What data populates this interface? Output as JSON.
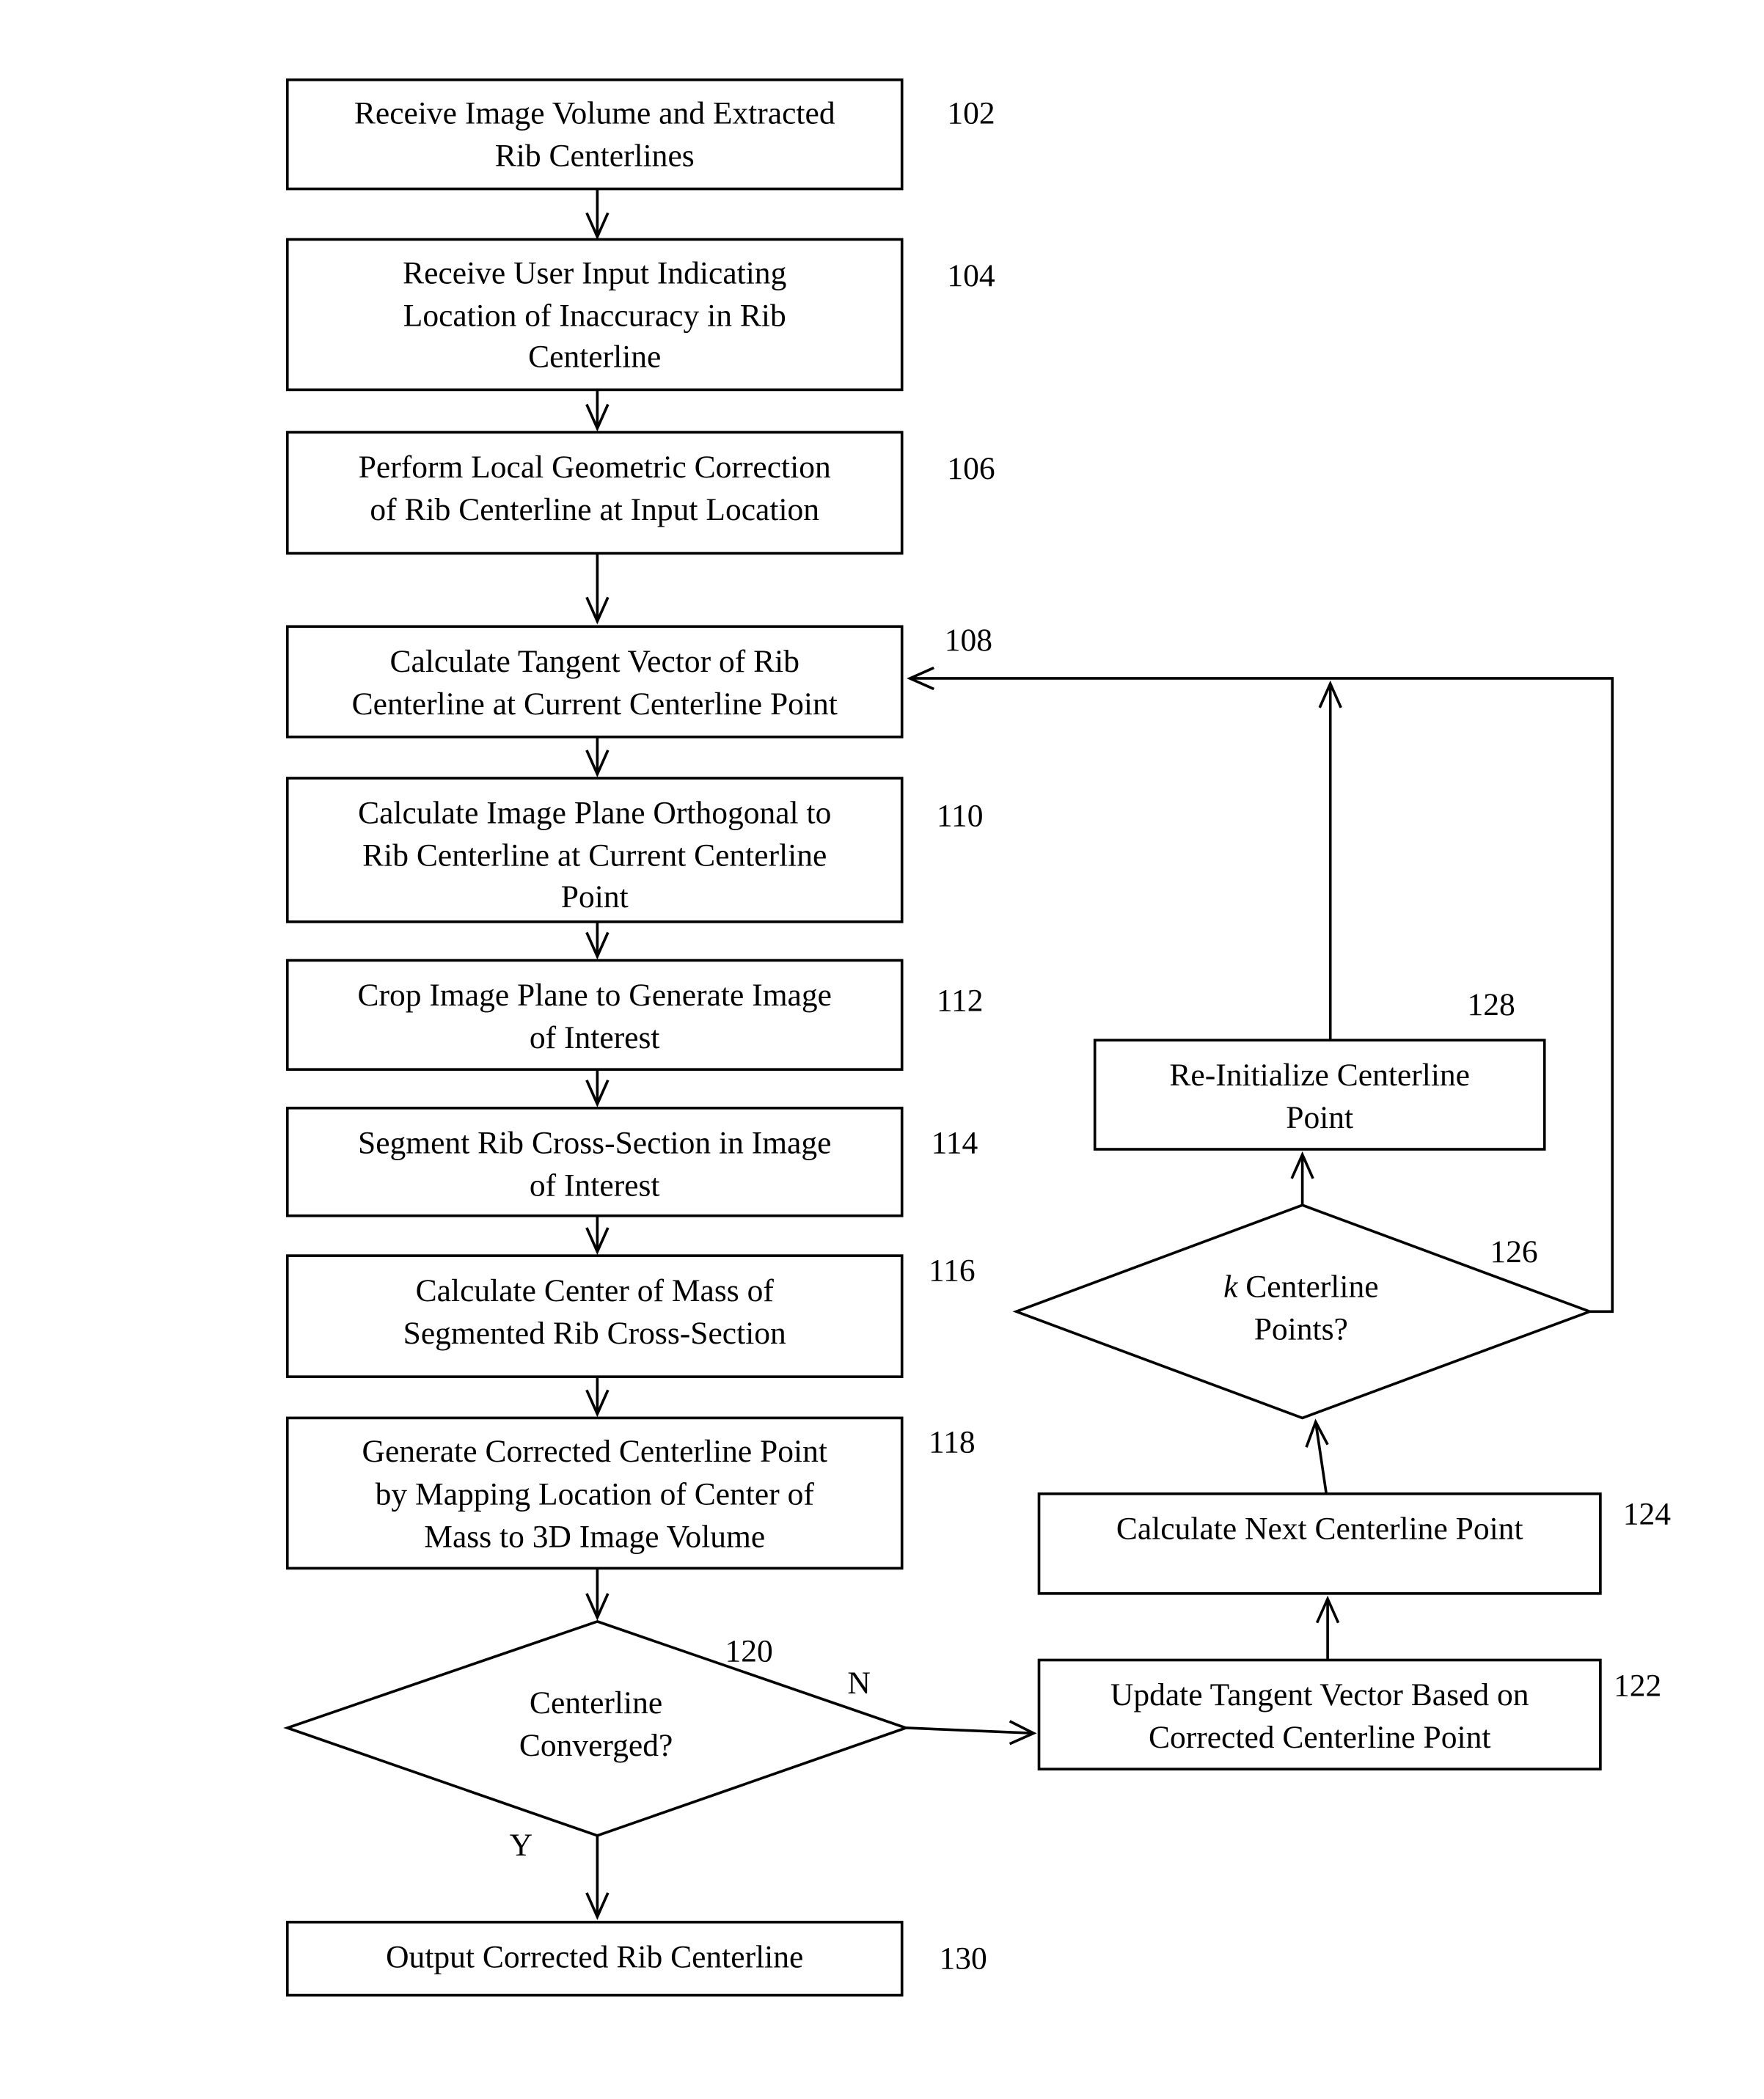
{
  "diagram": {
    "type": "flowchart",
    "steps": [
      {
        "id": "102",
        "ref": "102",
        "lines": [
          "Receive Image Volume and Extracted",
          "Rib Centerlines"
        ]
      },
      {
        "id": "104",
        "ref": "104",
        "lines": [
          "Receive User Input Indicating",
          "Location of Inaccuracy in Rib",
          "Centerline"
        ]
      },
      {
        "id": "106",
        "ref": "106",
        "lines": [
          "Perform Local Geometric Correction",
          "of Rib Centerline at Input Location"
        ]
      },
      {
        "id": "108",
        "ref": "108",
        "lines": [
          "Calculate Tangent Vector of Rib",
          "Centerline at Current Centerline Point"
        ]
      },
      {
        "id": "110",
        "ref": "110",
        "lines": [
          "Calculate Image Plane Orthogonal to",
          "Rib Centerline at Current Centerline",
          "Point"
        ]
      },
      {
        "id": "112",
        "ref": "112",
        "lines": [
          "Crop Image Plane to Generate Image",
          "of Interest"
        ]
      },
      {
        "id": "114",
        "ref": "114",
        "lines": [
          "Segment Rib Cross-Section in Image",
          "of Interest"
        ]
      },
      {
        "id": "116",
        "ref": "116",
        "lines": [
          "Calculate Center of Mass of",
          "Segmented Rib Cross-Section"
        ]
      },
      {
        "id": "118",
        "ref": "118",
        "lines": [
          "Generate Corrected Centerline Point",
          "by Mapping Location of Center of",
          "Mass to 3D Image Volume"
        ]
      },
      {
        "id": "120",
        "ref": "120",
        "lines": [
          "Centerline",
          "Converged?"
        ],
        "decision": true,
        "yes_label": "Y",
        "no_label": "N"
      },
      {
        "id": "122",
        "ref": "122",
        "lines": [
          "Update Tangent Vector Based on",
          "Corrected Centerline Point"
        ]
      },
      {
        "id": "124",
        "ref": "124",
        "lines": [
          "Calculate Next Centerline Point"
        ]
      },
      {
        "id": "126",
        "ref": "126",
        "lines": [
          "k",
          " Centerline",
          "Points?"
        ],
        "decision": true
      },
      {
        "id": "128",
        "ref": "128",
        "lines": [
          "Re-Initialize Centerline",
          "Point"
        ]
      },
      {
        "id": "130",
        "ref": "130",
        "lines": [
          "Output Corrected Rib Centerline"
        ]
      }
    ]
  }
}
